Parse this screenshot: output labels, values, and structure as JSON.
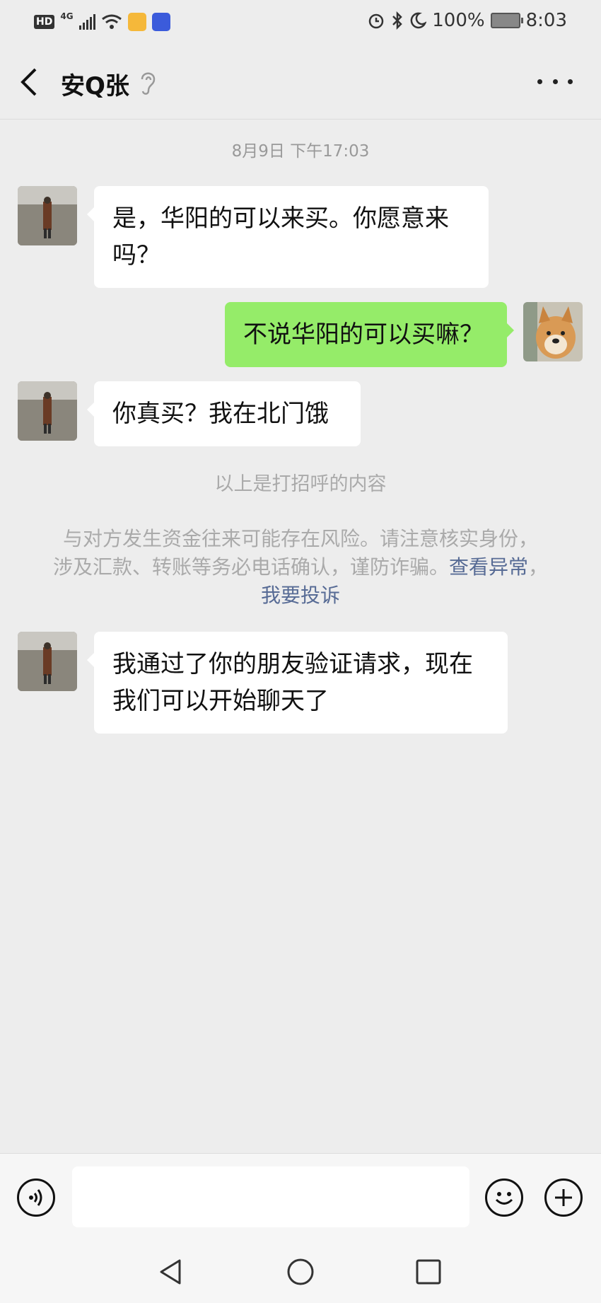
{
  "status_bar": {
    "hd": "HD",
    "network": "4G",
    "battery": "100%",
    "time": "8:03"
  },
  "header": {
    "title": "安Q张"
  },
  "chat": {
    "timestamp": "8月9日 下午17:03",
    "messages": [
      {
        "side": "left",
        "text_line1": "是，华阳的可以来买。你愿意来",
        "text_line2": "吗？"
      },
      {
        "side": "right",
        "text": "不说华阳的可以买嘛？"
      },
      {
        "side": "left",
        "text": "你真买？我在北门饿"
      },
      {
        "side": "left",
        "text_line1": "我通过了你的朋友验证请求，现在",
        "text_line2": "我们可以开始聊天了"
      }
    ],
    "greeting_note": "以上是打招呼的内容",
    "warning": {
      "line1": "与对方发生资金往来可能存在风险。请注意核实身份，",
      "line2": "涉及汇款、转账等务必电话确认，谨防诈骗。",
      "link_view": "查看异常",
      "separator": "，",
      "link_report": "我要投诉"
    }
  },
  "colors": {
    "background": "#ededed",
    "my_bubble": "#95ec69",
    "their_bubble": "#ffffff",
    "link": "#576b95"
  },
  "icons": [
    "back-arrow-icon",
    "ear-icon",
    "more-icon",
    "voice-icon",
    "emoji-icon",
    "plus-icon",
    "nav-back-icon",
    "nav-home-icon",
    "nav-recents-icon"
  ]
}
